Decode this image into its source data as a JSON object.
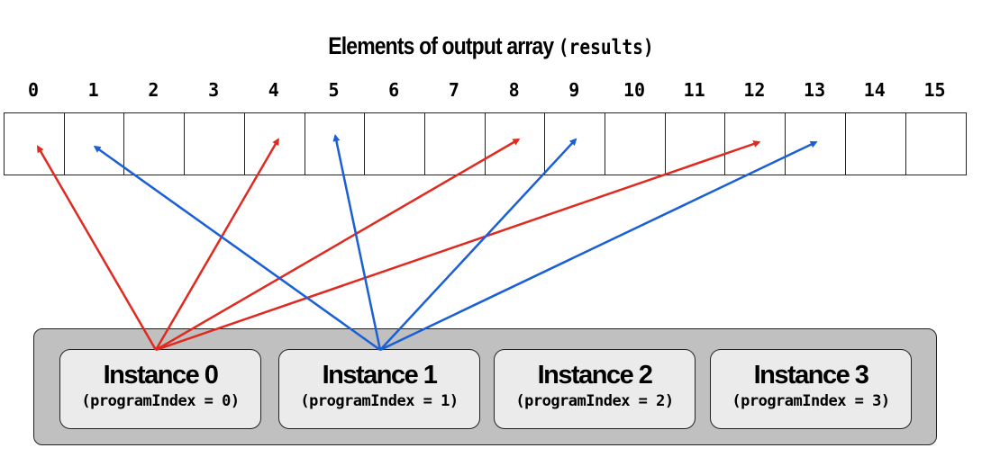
{
  "title": {
    "text": "Elements of output array ",
    "code": "(results)"
  },
  "indices": [
    "0",
    "1",
    "2",
    "3",
    "4",
    "5",
    "6",
    "7",
    "8",
    "9",
    "10",
    "11",
    "12",
    "13",
    "14",
    "15"
  ],
  "instances": [
    {
      "name": "Instance 0",
      "sub": "(programIndex = 0)",
      "targets": [
        0,
        4,
        8,
        12
      ],
      "color": "#e0291f"
    },
    {
      "name": "Instance 1",
      "sub": "(programIndex = 1)",
      "targets": [
        1,
        5,
        9,
        13
      ],
      "color": "#1a5fd6"
    },
    {
      "name": "Instance 2",
      "sub": "(programIndex = 2)",
      "targets": [],
      "color": "#e0291f"
    },
    {
      "name": "Instance 3",
      "sub": "(programIndex = 3)",
      "targets": [],
      "color": "#1a5fd6"
    }
  ]
}
